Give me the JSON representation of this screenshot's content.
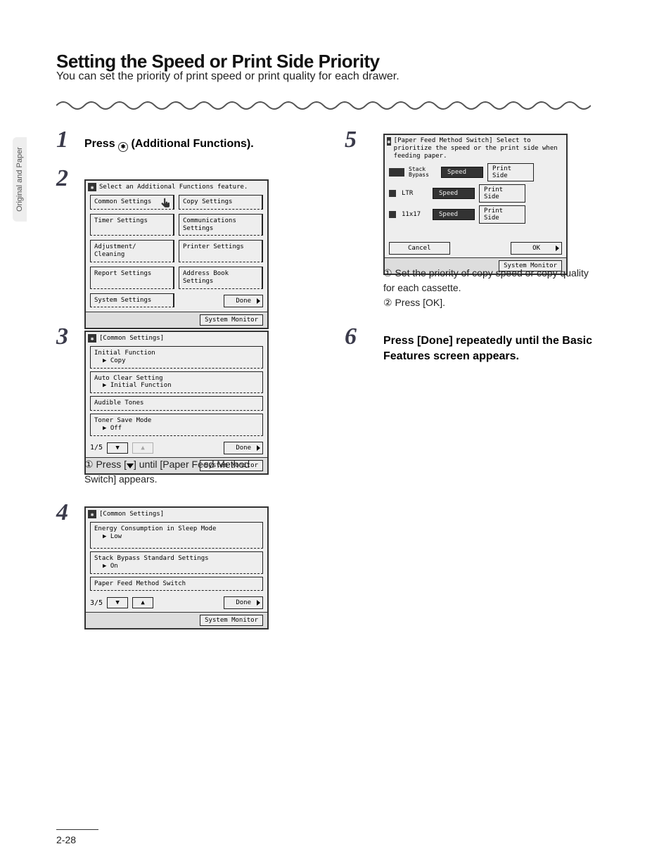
{
  "sideTab": "Original and Paper",
  "title": "Setting the Speed or Print Side Priority",
  "subtitle": "You can set the priority of print speed or print quality for each drawer.",
  "pageNum": "2-28",
  "step1": {
    "text_a": "Press ",
    "text_b": " (Additional Functions)."
  },
  "lcd2": {
    "header": "Select an Additional Functions feature.",
    "btns": [
      "Common Settings",
      "Copy Settings",
      "Timer Settings",
      "Communications Settings",
      "Adjustment/ Cleaning",
      "Printer Settings",
      "Report Settings",
      "Address Book Settings",
      "System Settings"
    ],
    "done": "Done",
    "sysmon": "System Monitor"
  },
  "lcd3": {
    "header": "[Common Settings]",
    "rows": [
      {
        "t": "Initial Function",
        "s": "▶ Copy"
      },
      {
        "t": "Auto Clear Setting",
        "s": "▶ Initial Function"
      },
      {
        "t": "Audible Tones",
        "s": ""
      },
      {
        "t": "Toner Save Mode",
        "s": "▶ Off"
      }
    ],
    "pg": "1/5",
    "done": "Done",
    "sysmon": "System Monitor"
  },
  "step3sub": {
    "circled": "①",
    "text_a": "Press [",
    "text_b": "] until [Paper Feed Method Switch] appears."
  },
  "lcd4": {
    "header": "[Common Settings]",
    "rows": [
      {
        "t": "Energy Consumption in Sleep Mode",
        "s": "▶ Low"
      },
      {
        "t": "Stack Bypass Standard Settings",
        "s": "▶ On"
      },
      {
        "t": "Paper Feed Method Switch",
        "s": ""
      }
    ],
    "pg": "3/5",
    "done": "Done",
    "sysmon": "System Monitor"
  },
  "lcd5": {
    "header": "[Paper Feed Method Switch] Select to prioritize the speed or the print side when feeding paper.",
    "rows": [
      {
        "label": "Stack Bypass",
        "speed": "Speed",
        "side": "Print Side",
        "icon": "bypass"
      },
      {
        "label": "LTR",
        "speed": "Speed",
        "side": "Print Side",
        "icon": "drawer1"
      },
      {
        "label": "11x17",
        "speed": "Speed",
        "side": "Print Side",
        "icon": "drawer2"
      }
    ],
    "cancel": "Cancel",
    "ok": "OK",
    "sysmon": "System Monitor"
  },
  "step5sub": {
    "l1c": "①",
    "l1t": "Set the priority of copy speed or copy quality for each cassette.",
    "l2c": "②",
    "l2t": "Press [OK]."
  },
  "step6": {
    "text": "Press [Done] repeatedly until the Basic Features screen appears."
  },
  "stepNums": {
    "s1": "1",
    "s2": "2",
    "s3": "3",
    "s4": "4",
    "s5": "5",
    "s6": "6"
  }
}
